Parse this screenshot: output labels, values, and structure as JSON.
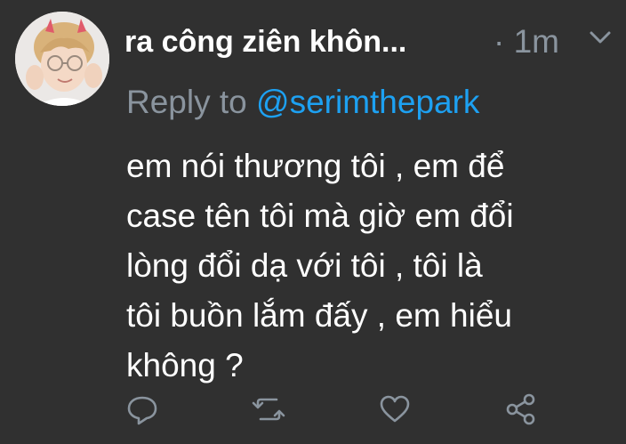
{
  "tweet": {
    "display_name": "ra công ziên khôn...",
    "timestamp": "· 1m",
    "reply_label": "Reply to",
    "reply_handle": "@serimthepark",
    "body_lines": [
      "em nói thương tôi , em để",
      "case tên tôi mà giờ em đổi",
      "lòng đổi dạ với tôi , tôi là",
      "tôi buồn lắm đấy , em hiểu",
      "không ?"
    ]
  },
  "actions": [
    {
      "name": "reply",
      "icon": "reply-icon"
    },
    {
      "name": "retweet",
      "icon": "retweet-icon"
    },
    {
      "name": "like",
      "icon": "heart-icon"
    },
    {
      "name": "share",
      "icon": "share-icon"
    }
  ],
  "colors": {
    "background": "#303030",
    "text": "#ffffff",
    "secondary": "#8a949e",
    "link": "#1da1f2"
  }
}
